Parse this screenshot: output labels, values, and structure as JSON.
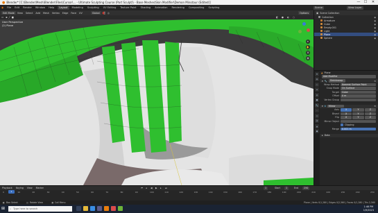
{
  "window": {
    "title": "Blender* [C:\\Blender\\Mesh\\Blender\\Files\\Cursor\\... - Ultimate Sculpting Course (Part Sculpt)\\ - Base Meshes\\Skin Modifier\\Demon Minotaur (Edited)]",
    "controls": [
      "—",
      "☐",
      "✕"
    ]
  },
  "menu": {
    "items": [
      "File",
      "Edit",
      "Render",
      "Window",
      "Help"
    ],
    "workspaces": [
      "Layout",
      "Modeling",
      "Sculpting",
      "UV Editing",
      "Texture Paint",
      "Shading",
      "Animation",
      "Rendering",
      "Compositing",
      "Scripting"
    ],
    "active_workspace": "Layout",
    "scene": "Scene",
    "view_layer": "View Layer"
  },
  "viewport": {
    "mode": "Edit Mode",
    "menus": [
      "View",
      "Select",
      "Add",
      "Mesh",
      "Vertex",
      "Edge",
      "Face",
      "UV"
    ],
    "orientation": "Global",
    "options": "Options",
    "info_line1": "User Perspective",
    "info_line2": "(2) Plane",
    "colors": {
      "background": "#3d3d3d",
      "mesh_green": "#2fbf2f",
      "mesh_white": "#e9e9e9"
    }
  },
  "outliner": {
    "header": "Scene Collection",
    "items": [
      {
        "label": "Collection",
        "icon": "collection-icon",
        "color": "#9a9a9a",
        "selected": false
      },
      {
        "label": "Armature",
        "icon": "armature-icon",
        "color": "#c47a32",
        "selected": false
      },
      {
        "label": "Cube",
        "icon": "mesh-icon",
        "color": "#d08a3a",
        "selected": false
      },
      {
        "label": "Empty.001",
        "icon": "empty-icon",
        "color": "#d08a3a",
        "selected": false
      },
      {
        "label": "Light",
        "icon": "light-icon",
        "color": "#d08a3a",
        "selected": false
      },
      {
        "label": "Plane",
        "icon": "mesh-icon",
        "color": "#d08a3a",
        "selected": true
      },
      {
        "label": "Sphere",
        "icon": "mesh-icon",
        "color": "#d08a3a",
        "selected": false
      }
    ]
  },
  "properties": {
    "object_name": "Plane",
    "add_modifier": "Add Modifier",
    "modifier1": {
      "name": "Shrinkwrap",
      "rows": [
        {
          "label": "Wrap Method",
          "value": "Nearest Surface Point"
        },
        {
          "label": "Snap Mode",
          "value": "On Surface"
        },
        {
          "label": "Target",
          "value": "Cube"
        },
        {
          "label": "Offset",
          "value": "0 m"
        },
        {
          "label": "Vertex Group",
          "value": ""
        }
      ]
    },
    "modifier2": {
      "name": "Mirror",
      "axis_label": "Axis",
      "bisect_label": "Bisect",
      "flip_label": "Flip",
      "axes": [
        "X",
        "Y",
        "Z"
      ],
      "mirror_object_label": "Mirror Object",
      "clipping_label": "Clipping",
      "merge_label": "Merge",
      "merge_value": "0.001 m"
    },
    "more_label": "Data"
  },
  "timeline": {
    "menus": [
      "Playback",
      "Keying",
      "View",
      "Marker"
    ],
    "current_frame": "1",
    "start_label": "Start",
    "start": "1",
    "end_label": "End",
    "end": "250",
    "ticks": [
      "0",
      "10",
      "20",
      "30",
      "40",
      "50",
      "60",
      "70",
      "80",
      "90",
      "100",
      "110",
      "120",
      "130",
      "140",
      "150",
      "160",
      "170",
      "180",
      "190",
      "200",
      "210",
      "220",
      "230",
      "240",
      "250"
    ]
  },
  "statusbar": {
    "items": [
      "Box Select",
      "Rotate View",
      "Call Menu"
    ],
    "stats": "Plane | Verts 0/1,280 | Edges 0/2,560 | Faces 0/1,280 | Tris 2,560"
  },
  "taskbar": {
    "search_placeholder": "Type here to search",
    "time": "1:46 PM",
    "date": "1/9/2023"
  }
}
